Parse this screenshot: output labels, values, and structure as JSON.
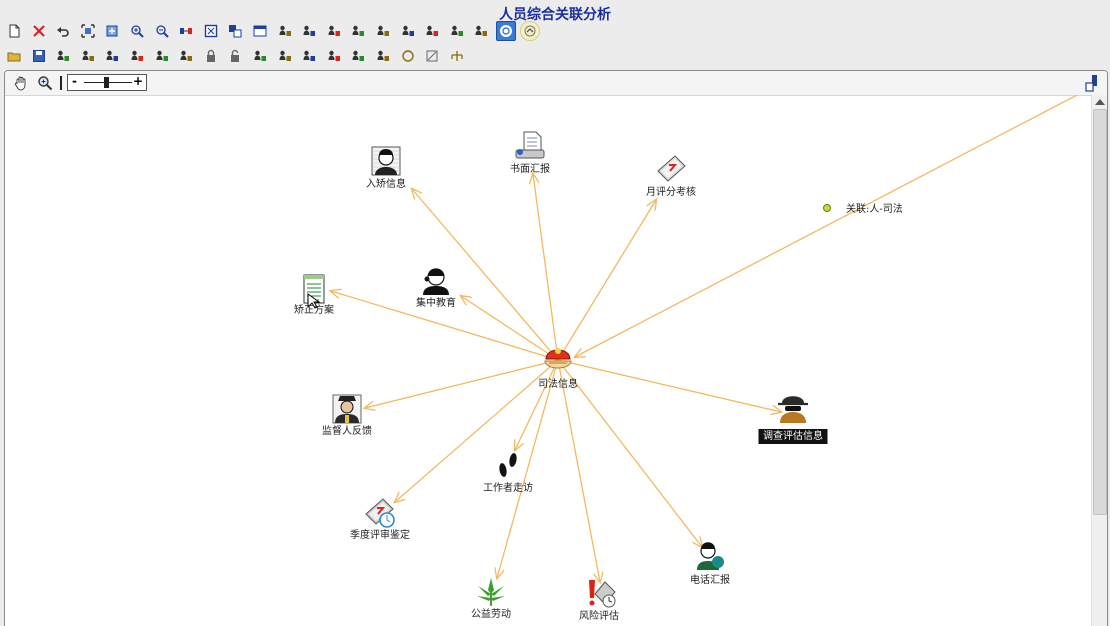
{
  "window": {
    "title": "人员综合关联分析"
  },
  "toolbar_row1": [
    {
      "icon": "new-document-icon",
      "state": "normal"
    },
    {
      "icon": "delete-icon",
      "state": "normal"
    },
    {
      "icon": "undo-icon",
      "state": "normal"
    },
    {
      "icon": "fit-window-icon",
      "state": "normal"
    },
    {
      "icon": "expand-icon",
      "state": "normal"
    },
    {
      "icon": "zoom-in-icon",
      "state": "normal"
    },
    {
      "icon": "zoom-out-icon",
      "state": "normal"
    },
    {
      "icon": "link-node-icon",
      "state": "normal"
    },
    {
      "icon": "frame-icon",
      "state": "normal"
    },
    {
      "icon": "layout-icon",
      "state": "normal"
    },
    {
      "icon": "window-icon",
      "state": "normal"
    },
    {
      "icon": "people-icon",
      "state": "normal"
    },
    {
      "icon": "people-search-icon",
      "state": "normal"
    },
    {
      "icon": "people-link-icon",
      "state": "normal"
    },
    {
      "icon": "people-red-icon",
      "state": "normal"
    },
    {
      "icon": "people-blue-icon",
      "state": "normal"
    },
    {
      "icon": "people-green-icon",
      "state": "normal"
    },
    {
      "icon": "people-arrow-icon",
      "state": "normal"
    },
    {
      "icon": "people-filter-icon",
      "state": "normal"
    },
    {
      "icon": "network-icon",
      "state": "normal"
    },
    {
      "icon": "globe-icon",
      "state": "active"
    },
    {
      "icon": "up-circle-icon",
      "state": "round"
    }
  ],
  "toolbar_row2": [
    {
      "icon": "open-folder-icon"
    },
    {
      "icon": "save-icon"
    },
    {
      "icon": "export-icon"
    },
    {
      "icon": "import-icon"
    },
    {
      "icon": "tray-down-icon"
    },
    {
      "icon": "tray-up-icon"
    },
    {
      "icon": "arrow-right-in-icon"
    },
    {
      "icon": "arrow-left-in-icon"
    },
    {
      "icon": "lock-icon"
    },
    {
      "icon": "unlock-icon"
    },
    {
      "icon": "hide-link-icon"
    },
    {
      "icon": "hide-link-red-icon"
    },
    {
      "icon": "filter-link-icon"
    },
    {
      "icon": "filter-link-red-icon"
    },
    {
      "icon": "hand-vote-icon"
    },
    {
      "icon": "stack-icon"
    },
    {
      "icon": "circle-layout-icon"
    },
    {
      "icon": "disable-icon"
    },
    {
      "icon": "tree-layout-icon"
    }
  ],
  "canvas_toolbar": {
    "pan_icon": "hand-icon",
    "zoom_icon": "magnifier-icon",
    "zoom_minus": "-",
    "zoom_plus": "+",
    "zoom_level": 0.45
  },
  "graph": {
    "edge_color": "#f4b860",
    "center": {
      "label": "司法信息",
      "icon": "court-emblem-icon"
    },
    "nodes": [
      {
        "label": "入矫信息",
        "icon": "person-photo-icon"
      },
      {
        "label": "书面汇报",
        "icon": "document-icon"
      },
      {
        "label": "月评分考核",
        "icon": "score-book-icon"
      },
      {
        "label": "关联:人-司法",
        "icon": "link-dot-icon"
      },
      {
        "label": "矫正方案",
        "icon": "notepad-icon"
      },
      {
        "label": "集中教育",
        "icon": "person-headset-icon"
      },
      {
        "label": "监督人反馈",
        "icon": "officer-icon"
      },
      {
        "label": "调查评估信息",
        "icon": "detective-icon",
        "highlighted": true
      },
      {
        "label": "工作者走访",
        "icon": "footprints-icon"
      },
      {
        "label": "季度评审鉴定",
        "icon": "review-book-icon"
      },
      {
        "label": "电话汇报",
        "icon": "phone-person-icon"
      },
      {
        "label": "公益劳动",
        "icon": "plant-icon"
      },
      {
        "label": "风险评估",
        "icon": "risk-icon"
      }
    ]
  }
}
